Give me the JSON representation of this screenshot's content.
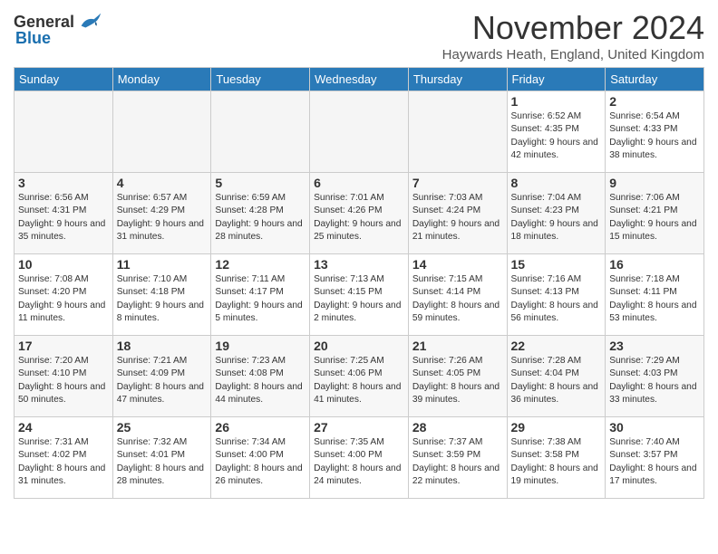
{
  "header": {
    "logo_general": "General",
    "logo_blue": "Blue",
    "title": "November 2024",
    "subtitle": "Haywards Heath, England, United Kingdom"
  },
  "columns": [
    "Sunday",
    "Monday",
    "Tuesday",
    "Wednesday",
    "Thursday",
    "Friday",
    "Saturday"
  ],
  "weeks": [
    [
      {
        "day": "",
        "info": ""
      },
      {
        "day": "",
        "info": ""
      },
      {
        "day": "",
        "info": ""
      },
      {
        "day": "",
        "info": ""
      },
      {
        "day": "",
        "info": ""
      },
      {
        "day": "1",
        "info": "Sunrise: 6:52 AM\nSunset: 4:35 PM\nDaylight: 9 hours and 42 minutes."
      },
      {
        "day": "2",
        "info": "Sunrise: 6:54 AM\nSunset: 4:33 PM\nDaylight: 9 hours and 38 minutes."
      }
    ],
    [
      {
        "day": "3",
        "info": "Sunrise: 6:56 AM\nSunset: 4:31 PM\nDaylight: 9 hours and 35 minutes."
      },
      {
        "day": "4",
        "info": "Sunrise: 6:57 AM\nSunset: 4:29 PM\nDaylight: 9 hours and 31 minutes."
      },
      {
        "day": "5",
        "info": "Sunrise: 6:59 AM\nSunset: 4:28 PM\nDaylight: 9 hours and 28 minutes."
      },
      {
        "day": "6",
        "info": "Sunrise: 7:01 AM\nSunset: 4:26 PM\nDaylight: 9 hours and 25 minutes."
      },
      {
        "day": "7",
        "info": "Sunrise: 7:03 AM\nSunset: 4:24 PM\nDaylight: 9 hours and 21 minutes."
      },
      {
        "day": "8",
        "info": "Sunrise: 7:04 AM\nSunset: 4:23 PM\nDaylight: 9 hours and 18 minutes."
      },
      {
        "day": "9",
        "info": "Sunrise: 7:06 AM\nSunset: 4:21 PM\nDaylight: 9 hours and 15 minutes."
      }
    ],
    [
      {
        "day": "10",
        "info": "Sunrise: 7:08 AM\nSunset: 4:20 PM\nDaylight: 9 hours and 11 minutes."
      },
      {
        "day": "11",
        "info": "Sunrise: 7:10 AM\nSunset: 4:18 PM\nDaylight: 9 hours and 8 minutes."
      },
      {
        "day": "12",
        "info": "Sunrise: 7:11 AM\nSunset: 4:17 PM\nDaylight: 9 hours and 5 minutes."
      },
      {
        "day": "13",
        "info": "Sunrise: 7:13 AM\nSunset: 4:15 PM\nDaylight: 9 hours and 2 minutes."
      },
      {
        "day": "14",
        "info": "Sunrise: 7:15 AM\nSunset: 4:14 PM\nDaylight: 8 hours and 59 minutes."
      },
      {
        "day": "15",
        "info": "Sunrise: 7:16 AM\nSunset: 4:13 PM\nDaylight: 8 hours and 56 minutes."
      },
      {
        "day": "16",
        "info": "Sunrise: 7:18 AM\nSunset: 4:11 PM\nDaylight: 8 hours and 53 minutes."
      }
    ],
    [
      {
        "day": "17",
        "info": "Sunrise: 7:20 AM\nSunset: 4:10 PM\nDaylight: 8 hours and 50 minutes."
      },
      {
        "day": "18",
        "info": "Sunrise: 7:21 AM\nSunset: 4:09 PM\nDaylight: 8 hours and 47 minutes."
      },
      {
        "day": "19",
        "info": "Sunrise: 7:23 AM\nSunset: 4:08 PM\nDaylight: 8 hours and 44 minutes."
      },
      {
        "day": "20",
        "info": "Sunrise: 7:25 AM\nSunset: 4:06 PM\nDaylight: 8 hours and 41 minutes."
      },
      {
        "day": "21",
        "info": "Sunrise: 7:26 AM\nSunset: 4:05 PM\nDaylight: 8 hours and 39 minutes."
      },
      {
        "day": "22",
        "info": "Sunrise: 7:28 AM\nSunset: 4:04 PM\nDaylight: 8 hours and 36 minutes."
      },
      {
        "day": "23",
        "info": "Sunrise: 7:29 AM\nSunset: 4:03 PM\nDaylight: 8 hours and 33 minutes."
      }
    ],
    [
      {
        "day": "24",
        "info": "Sunrise: 7:31 AM\nSunset: 4:02 PM\nDaylight: 8 hours and 31 minutes."
      },
      {
        "day": "25",
        "info": "Sunrise: 7:32 AM\nSunset: 4:01 PM\nDaylight: 8 hours and 28 minutes."
      },
      {
        "day": "26",
        "info": "Sunrise: 7:34 AM\nSunset: 4:00 PM\nDaylight: 8 hours and 26 minutes."
      },
      {
        "day": "27",
        "info": "Sunrise: 7:35 AM\nSunset: 4:00 PM\nDaylight: 8 hours and 24 minutes."
      },
      {
        "day": "28",
        "info": "Sunrise: 7:37 AM\nSunset: 3:59 PM\nDaylight: 8 hours and 22 minutes."
      },
      {
        "day": "29",
        "info": "Sunrise: 7:38 AM\nSunset: 3:58 PM\nDaylight: 8 hours and 19 minutes."
      },
      {
        "day": "30",
        "info": "Sunrise: 7:40 AM\nSunset: 3:57 PM\nDaylight: 8 hours and 17 minutes."
      }
    ]
  ]
}
